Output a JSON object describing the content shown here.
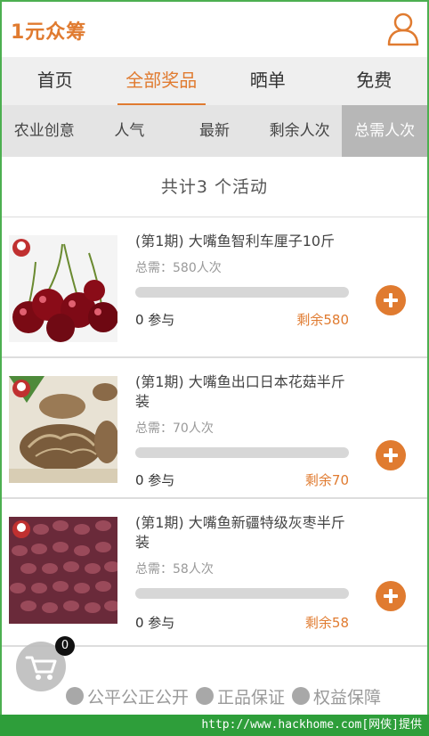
{
  "header": {
    "title": "1元众筹",
    "user_icon": "user-outline-icon"
  },
  "nav": {
    "tabs": [
      {
        "label": "首页",
        "active": false
      },
      {
        "label": "全部奖品",
        "active": true
      },
      {
        "label": "晒单",
        "active": false
      },
      {
        "label": "免费",
        "active": false
      }
    ]
  },
  "filters": {
    "items": [
      {
        "label": "农业创意",
        "active": false
      },
      {
        "label": "人气",
        "active": false
      },
      {
        "label": "最新",
        "active": false
      },
      {
        "label": "剩余人次",
        "active": false
      },
      {
        "label": "总需人次",
        "active": true
      }
    ]
  },
  "summary": {
    "text": "共计3 个活动"
  },
  "products": [
    {
      "title": "(第1期) 大嘴鱼智利车厘子10斤",
      "need": "总需：580人次",
      "joined": "0 参与",
      "remaining": "剩余580",
      "progress": 0,
      "image": "cherries"
    },
    {
      "title": "(第1期) 大嘴鱼出口日本花菇半斤装",
      "need": "总需：70人次",
      "joined": "0 参与",
      "remaining": "剩余70",
      "progress": 0,
      "image": "shiitake-mushrooms"
    },
    {
      "title": "(第1期) 大嘴鱼新疆特级灰枣半斤装",
      "need": "总需：58人次",
      "joined": "0 参与",
      "remaining": "剩余58",
      "progress": 0,
      "image": "red-dates"
    }
  ],
  "footer": {
    "guarantees": [
      {
        "label": "公平公正公开",
        "icon": "scale-icon"
      },
      {
        "label": "正品保证",
        "icon": "certificate-icon"
      },
      {
        "label": "权益保障",
        "icon": "shield-icon"
      }
    ]
  },
  "cart": {
    "count": "0",
    "icon": "cart-icon"
  },
  "watermark": {
    "text": "http://www.hackhome.com[网侠]提供"
  },
  "colors": {
    "accent": "#e07b30",
    "nav_bg": "#efefef",
    "filter_bg": "#e4e4e4",
    "filter_active": "#b7b7b7",
    "watermark_bg": "#2e9e3a"
  }
}
